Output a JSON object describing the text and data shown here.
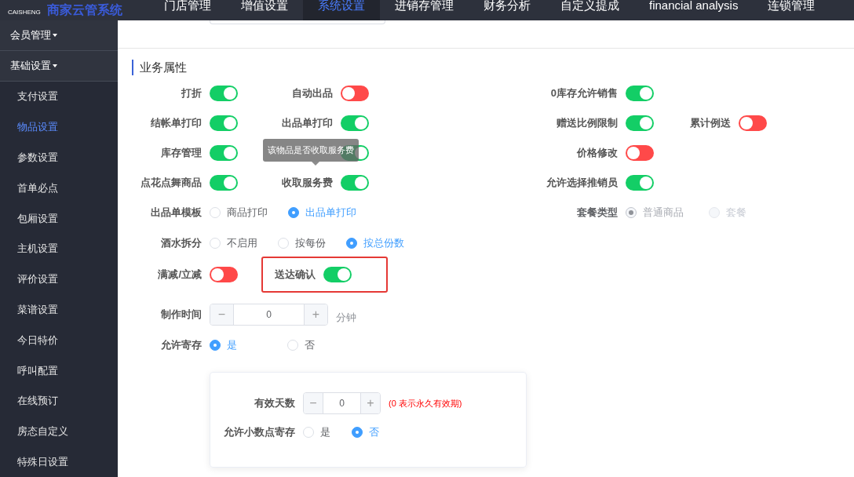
{
  "header": {
    "logo_text": "CAISHENG",
    "brand": "商家云管系统",
    "nav": [
      {
        "label": "门店管理",
        "selected": false
      },
      {
        "label": "增值设置",
        "selected": false
      },
      {
        "label": "系统设置",
        "selected": true
      },
      {
        "label": "进销存管理",
        "selected": false
      },
      {
        "label": "财务分析",
        "selected": false
      },
      {
        "label": "自定义提成",
        "selected": false
      },
      {
        "label": "financial analysis",
        "selected": false
      },
      {
        "label": "连锁管理",
        "selected": false
      }
    ]
  },
  "sidebar": {
    "groups": [
      {
        "label": "会员管理"
      },
      {
        "label": "基础设置",
        "items": [
          {
            "label": "支付设置",
            "selected": false
          },
          {
            "label": "物品设置",
            "selected": true
          },
          {
            "label": "参数设置",
            "selected": false
          },
          {
            "label": "首单必点",
            "selected": false
          },
          {
            "label": "包厢设置",
            "selected": false
          },
          {
            "label": "主机设置",
            "selected": false
          },
          {
            "label": "评价设置",
            "selected": false
          },
          {
            "label": "菜谱设置",
            "selected": false
          },
          {
            "label": "今日特价",
            "selected": false
          },
          {
            "label": "呼叫配置",
            "selected": false
          },
          {
            "label": "在线预订",
            "selected": false
          },
          {
            "label": "房态自定义",
            "selected": false
          },
          {
            "label": "特殊日设置",
            "selected": false
          }
        ]
      }
    ]
  },
  "section_title": "业务属性",
  "switches_left": [
    [
      {
        "label": "打折",
        "on": true
      },
      {
        "label": "自动出品",
        "on": false
      }
    ],
    [
      {
        "label": "结帐单打印",
        "on": true
      },
      {
        "label": "出品单打印",
        "on": true
      }
    ],
    [
      {
        "label": "库存管理",
        "on": true
      },
      {
        "on": true,
        "tooltip": "该物品是否收取服务费"
      }
    ],
    [
      {
        "label": "点花点舞商品",
        "on": true
      },
      {
        "label": "收取服务费",
        "on": true
      }
    ]
  ],
  "switches_right": [
    [
      {
        "label": "0库存允许销售",
        "on": true
      }
    ],
    [
      {
        "label": "赠送比例限制",
        "on": true
      },
      {
        "label": "累计例送",
        "on": false
      }
    ],
    [
      {
        "label": "价格修改",
        "on": false
      }
    ],
    [
      {
        "label": "允许选择推销员",
        "on": true
      }
    ]
  ],
  "print_template": {
    "label": "出品单模板",
    "options": [
      {
        "label": "商品打印",
        "selected": false
      },
      {
        "label": "出品单打印",
        "selected": true
      }
    ]
  },
  "package_type": {
    "label": "套餐类型",
    "disabled": true,
    "options": [
      {
        "label": "普通商品",
        "selected": true
      },
      {
        "label": "套餐",
        "selected": false
      }
    ]
  },
  "drink_split": {
    "label": "酒水拆分",
    "options": [
      {
        "label": "不启用",
        "selected": false
      },
      {
        "label": "按每份",
        "selected": false
      },
      {
        "label": "按总份数",
        "selected": true
      }
    ]
  },
  "discount": {
    "label": "满减/立减",
    "on": false
  },
  "delivery_confirm": {
    "label": "送达确认",
    "on": true,
    "highlighted": true
  },
  "make_time": {
    "label": "制作时间",
    "minus": "−",
    "value": "0",
    "plus": "+",
    "unit": "分钟"
  },
  "allow_storage": {
    "label": "允许寄存",
    "options": [
      {
        "label": "是",
        "selected": true
      },
      {
        "label": "否",
        "selected": false
      }
    ]
  },
  "storage_card": {
    "days": {
      "label": "有效天数",
      "minus": "−",
      "value": "0",
      "plus": "+",
      "note": "(0 表示永久有效期)"
    },
    "decimal": {
      "label": "允许小数点寄存",
      "options": [
        {
          "label": "是",
          "selected": false
        },
        {
          "label": "否",
          "selected": true
        }
      ]
    }
  }
}
